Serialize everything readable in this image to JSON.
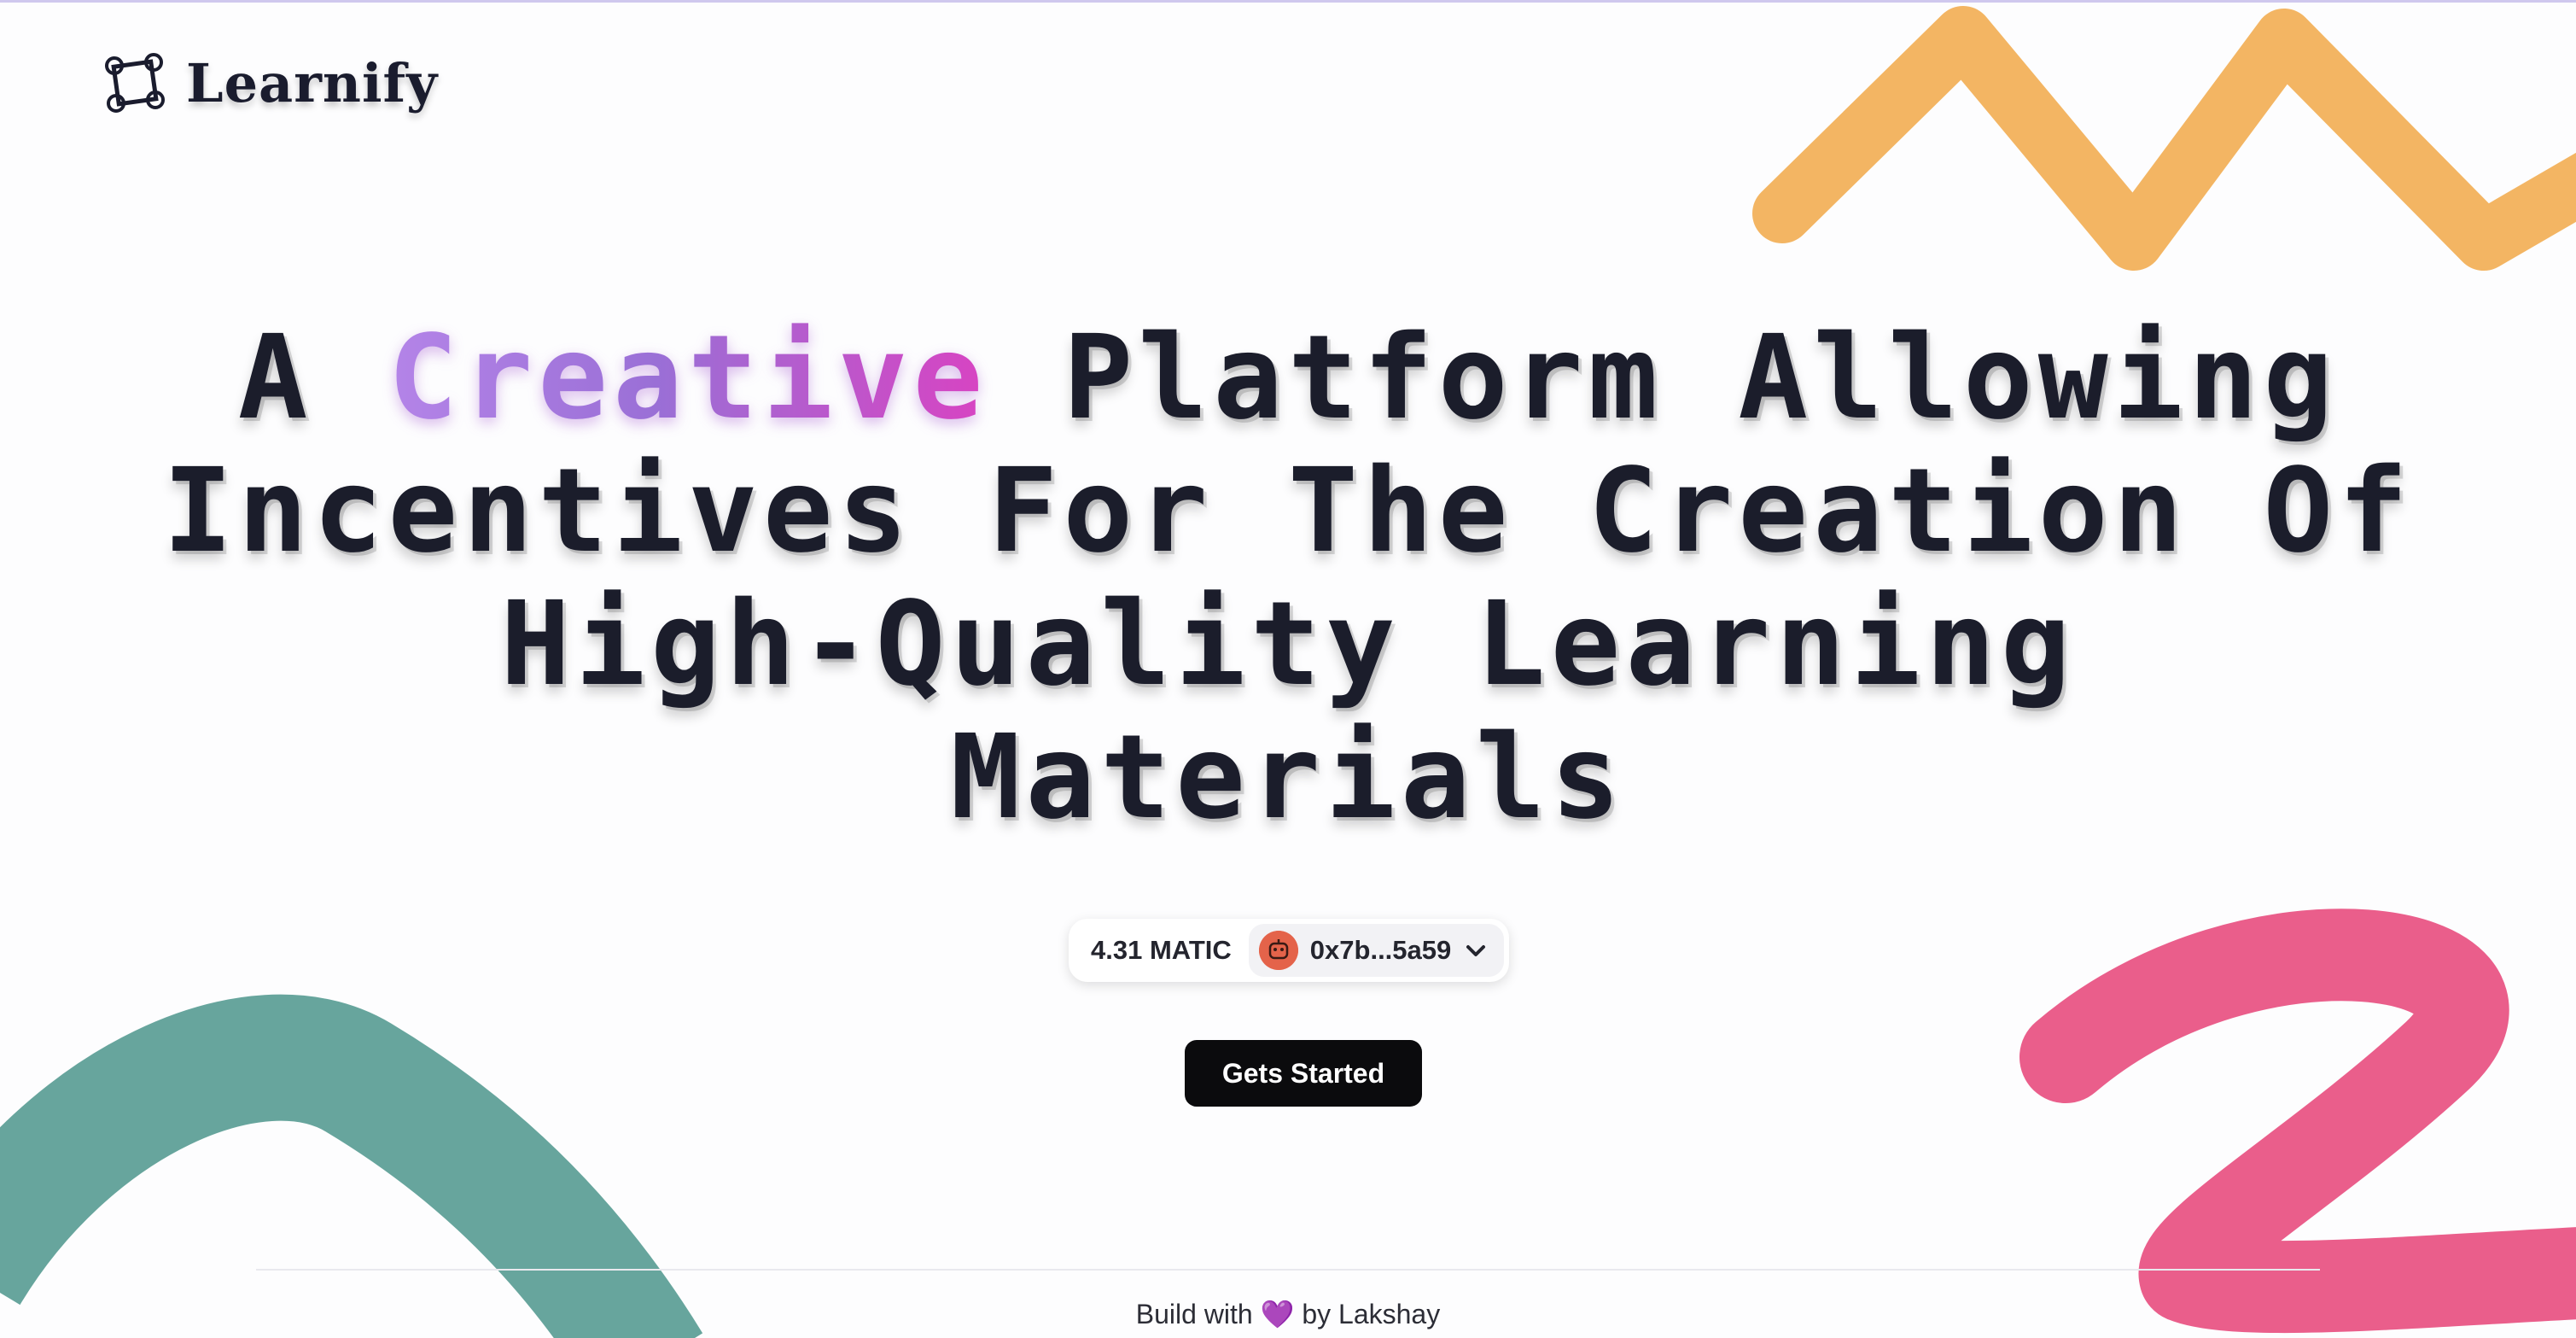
{
  "colors": {
    "background": "#fdfdfe",
    "text": "#1b1d2b",
    "accent_gradient_start": "#b484e8",
    "accent_gradient_end": "#d843c2",
    "deco_orange": "#f3b563",
    "deco_pink": "#ea5e8b",
    "deco_teal": "#67a59d",
    "button_bg": "#0b0b0d",
    "avatar": "#e4634a"
  },
  "header": {
    "logo_text": "Learnify",
    "logo_icon": "hands-square-icon"
  },
  "hero": {
    "line1_pre": "A ",
    "highlight": "Creative",
    "line1_post": " Platform Allowing",
    "line2": "Incentives For The Creation Of",
    "line3": "High-Quality Learning",
    "line4": "Materials"
  },
  "wallet": {
    "balance": "4.31 MATIC",
    "address": "0x7b...5a59",
    "avatar_icon": "robot-avatar-icon",
    "dropdown_icon": "chevron-down-icon"
  },
  "cta": {
    "label": "Gets Started"
  },
  "footer": {
    "prefix": "Build with",
    "heart": "💜",
    "suffix": "by Lakshay"
  }
}
